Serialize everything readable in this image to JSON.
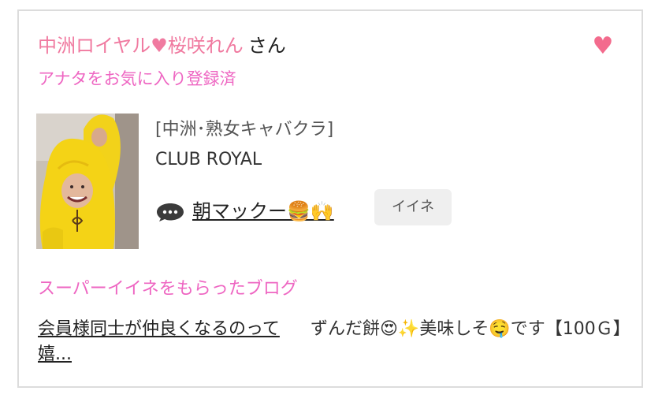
{
  "user": {
    "name": "中洲ロイヤル♥桜咲れん",
    "suffix": "さん",
    "favorite_note": "アナタをお気に入り登録済"
  },
  "favorite_icon": "heart-icon",
  "accent_color": "#f07aa0",
  "post": {
    "shop_category": "[中洲･熟女キャバクラ]",
    "shop_name": "CLUB ROYAL",
    "comment_icon": "speech-bubble-icon",
    "title": "朝マックー🍔🙌",
    "like_label": "イイネ"
  },
  "super_like": {
    "heading": "スーパーイイネをもらったブログ",
    "blog_title": "会員様同士が仲良くなるのって嬉...",
    "excerpt": "ずんだ餅😍✨美味しそ🤤です【100Ｇ】"
  }
}
